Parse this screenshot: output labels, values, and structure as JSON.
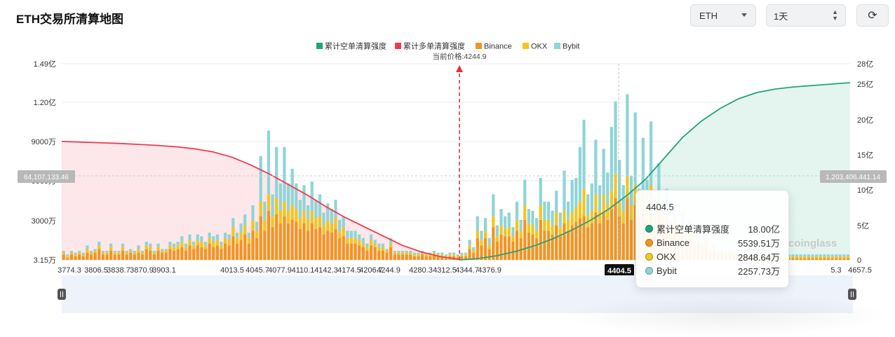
{
  "header": {
    "title": "ETH交易所清算地图"
  },
  "controls": {
    "coin": "ETH",
    "range": "1天",
    "refresh_icon": "refresh-icon"
  },
  "legend": [
    {
      "label": "累计空单清算强度",
      "color": "#1fa37f"
    },
    {
      "label": "累计多单清算强度",
      "color": "#ef3b4f"
    },
    {
      "label": "Binance",
      "color": "#f39422"
    },
    {
      "label": "OKX",
      "color": "#f2c521"
    },
    {
      "label": "Bybit",
      "color": "#8fd4d7"
    }
  ],
  "current_price_label": "当前价格:4244.9",
  "watermark": "coinglass",
  "chart_data": {
    "type": "bar",
    "stacked": true,
    "xlabel": "",
    "ylabel": "",
    "x_tick_labels": [
      "3774.3",
      "3806.5",
      "3838.7",
      "3870.9",
      "3903.1",
      "4013.5",
      "4045.7",
      "4077.9",
      "4110.1",
      "4142.3",
      "4174.5",
      "4206.7",
      "4244.9",
      "4280.3",
      "4312.5",
      "4344.7",
      "4376.9",
      "4404.5",
      "5.3",
      "4657.5"
    ],
    "y_left_ticks": [
      "3.15万",
      "3000万",
      "6000万",
      "9000万",
      "1.20亿",
      "1.49亿"
    ],
    "y_right_ticks": [
      "0",
      "5亿",
      "10亿",
      "15亿",
      "20亿",
      "25亿",
      "28亿"
    ],
    "y_left_range": [
      0,
      149000000
    ],
    "y_right_range": [
      0,
      2800000000
    ],
    "current_price": 4244.9,
    "left_crosshair_value": "64,107,133.46",
    "right_crosshair_value": "1,203,406,441.14",
    "series": [
      {
        "name": "Binance",
        "color": "#f39422",
        "values": [
          3,
          1,
          3,
          2,
          3,
          2,
          4,
          3,
          4,
          6,
          3,
          3,
          5,
          3,
          3,
          5,
          3,
          4,
          3,
          4,
          3,
          6,
          5,
          3,
          5,
          4,
          4,
          6,
          5,
          6,
          7,
          5,
          8,
          6,
          8,
          7,
          6,
          9,
          7,
          8,
          6,
          9,
          8,
          13,
          9,
          11,
          14,
          9,
          16,
          12,
          24,
          16,
          27,
          18,
          25,
          20,
          24,
          20,
          22,
          21,
          17,
          20,
          16,
          20,
          17,
          18,
          14,
          16,
          15,
          17,
          12,
          13,
          9,
          9,
          9,
          8,
          7,
          5,
          8,
          7,
          5,
          5,
          4,
          7,
          3,
          3,
          3,
          3,
          3,
          2,
          2,
          3,
          2,
          2,
          3,
          2,
          2,
          1,
          2,
          2,
          1,
          2,
          2,
          6,
          4,
          12,
          8,
          12,
          6,
          18,
          10,
          14,
          13,
          13,
          10,
          16,
          12,
          22,
          15,
          14,
          12,
          22,
          16,
          16,
          14,
          19,
          13,
          20,
          16,
          19,
          21,
          23,
          24,
          18,
          20,
          26,
          20,
          26,
          22,
          28,
          34,
          24,
          20,
          34,
          22,
          30,
          20,
          27,
          22,
          30,
          18,
          24,
          18,
          20,
          12,
          16,
          10,
          14,
          9,
          12,
          7,
          9,
          5,
          7,
          4,
          5,
          3,
          4,
          2,
          3,
          2,
          2,
          1,
          2,
          1,
          2,
          1,
          1,
          1,
          1,
          1,
          1,
          1,
          1,
          1,
          1,
          1,
          1,
          1,
          1,
          1,
          1,
          1,
          1,
          1,
          1,
          1,
          1,
          1,
          1
        ]
      },
      {
        "name": "OKX",
        "color": "#f2c521",
        "values": [
          1,
          1,
          1,
          1,
          1,
          1,
          2,
          1,
          1,
          2,
          1,
          1,
          2,
          1,
          1,
          2,
          1,
          1,
          1,
          2,
          1,
          2,
          2,
          1,
          2,
          1,
          1,
          2,
          2,
          2,
          3,
          2,
          3,
          2,
          3,
          3,
          2,
          3,
          3,
          3,
          2,
          3,
          3,
          5,
          3,
          4,
          5,
          3,
          6,
          4,
          8,
          6,
          9,
          6,
          9,
          7,
          8,
          7,
          8,
          7,
          6,
          7,
          6,
          7,
          6,
          6,
          5,
          6,
          5,
          6,
          4,
          5,
          3,
          3,
          3,
          3,
          2,
          2,
          3,
          2,
          2,
          2,
          1,
          2,
          1,
          1,
          1,
          1,
          1,
          1,
          1,
          1,
          1,
          1,
          1,
          1,
          1,
          1,
          1,
          1,
          1,
          1,
          1,
          2,
          1,
          4,
          3,
          4,
          2,
          6,
          3,
          5,
          4,
          5,
          3,
          6,
          4,
          8,
          5,
          5,
          4,
          8,
          6,
          6,
          5,
          7,
          5,
          7,
          6,
          7,
          8,
          9,
          15,
          6,
          7,
          10,
          7,
          10,
          8,
          10,
          13,
          9,
          7,
          12,
          8,
          11,
          7,
          10,
          8,
          11,
          6,
          9,
          6,
          7,
          4,
          6,
          4,
          5,
          3,
          4,
          3,
          3,
          2,
          3,
          1,
          2,
          1,
          1,
          1,
          1,
          1,
          1,
          1,
          1,
          1,
          1,
          1,
          1,
          1,
          1,
          1,
          1,
          1,
          1,
          1,
          1,
          1,
          1,
          1,
          1,
          1,
          1,
          1,
          1,
          1,
          1,
          1,
          1,
          1,
          1
        ]
      },
      {
        "name": "Bybit",
        "color": "#8fd4d7",
        "values": [
          1,
          1,
          1,
          1,
          1,
          1,
          2,
          1,
          1,
          2,
          1,
          1,
          2,
          1,
          1,
          2,
          1,
          1,
          1,
          2,
          1,
          2,
          2,
          1,
          2,
          1,
          1,
          2,
          2,
          2,
          3,
          2,
          3,
          2,
          3,
          3,
          2,
          3,
          3,
          3,
          2,
          3,
          3,
          5,
          3,
          5,
          6,
          3,
          8,
          5,
          25,
          10,
          35,
          12,
          28,
          15,
          30,
          15,
          20,
          14,
          10,
          14,
          8,
          16,
          10,
          12,
          7,
          9,
          8,
          10,
          6,
          6,
          4,
          4,
          4,
          3,
          3,
          2,
          3,
          2,
          2,
          2,
          1,
          3,
          1,
          1,
          1,
          1,
          1,
          1,
          1,
          1,
          1,
          1,
          1,
          1,
          1,
          1,
          1,
          1,
          1,
          1,
          1,
          3,
          2,
          8,
          5,
          7,
          4,
          12,
          6,
          9,
          7,
          8,
          5,
          10,
          6,
          14,
          8,
          8,
          7,
          15,
          10,
          10,
          8,
          12,
          8,
          22,
          10,
          18,
          16,
          30,
          38,
          12,
          15,
          30,
          14,
          25,
          18,
          35,
          40,
          22,
          14,
          45,
          16,
          40,
          12,
          30,
          14,
          35,
          10,
          20,
          9,
          12,
          6,
          9,
          5,
          7,
          4,
          6,
          3,
          4,
          2,
          3,
          2,
          2,
          1,
          1,
          1,
          1,
          1,
          1,
          1,
          1,
          1,
          1,
          1,
          1,
          1,
          1,
          1,
          1,
          1,
          1,
          1,
          1,
          1,
          1,
          1,
          1,
          1,
          1,
          1,
          1,
          1,
          1,
          1,
          1,
          1,
          1
        ]
      },
      {
        "name": "累计多单清算强度",
        "color": "#ef3b4f",
        "values": [
          9000,
          8950,
          8900,
          8850,
          8780,
          8700,
          8600,
          8450,
          8200,
          7800,
          7200,
          6500,
          5700,
          4900,
          4000,
          3200,
          2500,
          1800,
          1100,
          600,
          250,
          50
        ]
      },
      {
        "name": "累计空单清算强度",
        "color": "#1fa37f",
        "values": [
          0,
          200,
          600,
          1200,
          2000,
          3000,
          4200,
          5600,
          7200,
          9200,
          11500,
          14500,
          17500,
          19800,
          21600,
          23000,
          23900,
          24400,
          24700,
          24900,
          25100,
          25300
        ]
      }
    ]
  },
  "tooltip": {
    "title": "4404.5",
    "rows": [
      {
        "name": "累计空单清算强度",
        "value": "18.00亿",
        "color": "#1fa37f"
      },
      {
        "name": "Binance",
        "value": "5539.51万",
        "color": "#f39422"
      },
      {
        "name": "OKX",
        "value": "2848.64万",
        "color": "#f2c521"
      },
      {
        "name": "Bybit",
        "value": "2257.73万",
        "color": "#8fd4d7"
      }
    ]
  }
}
